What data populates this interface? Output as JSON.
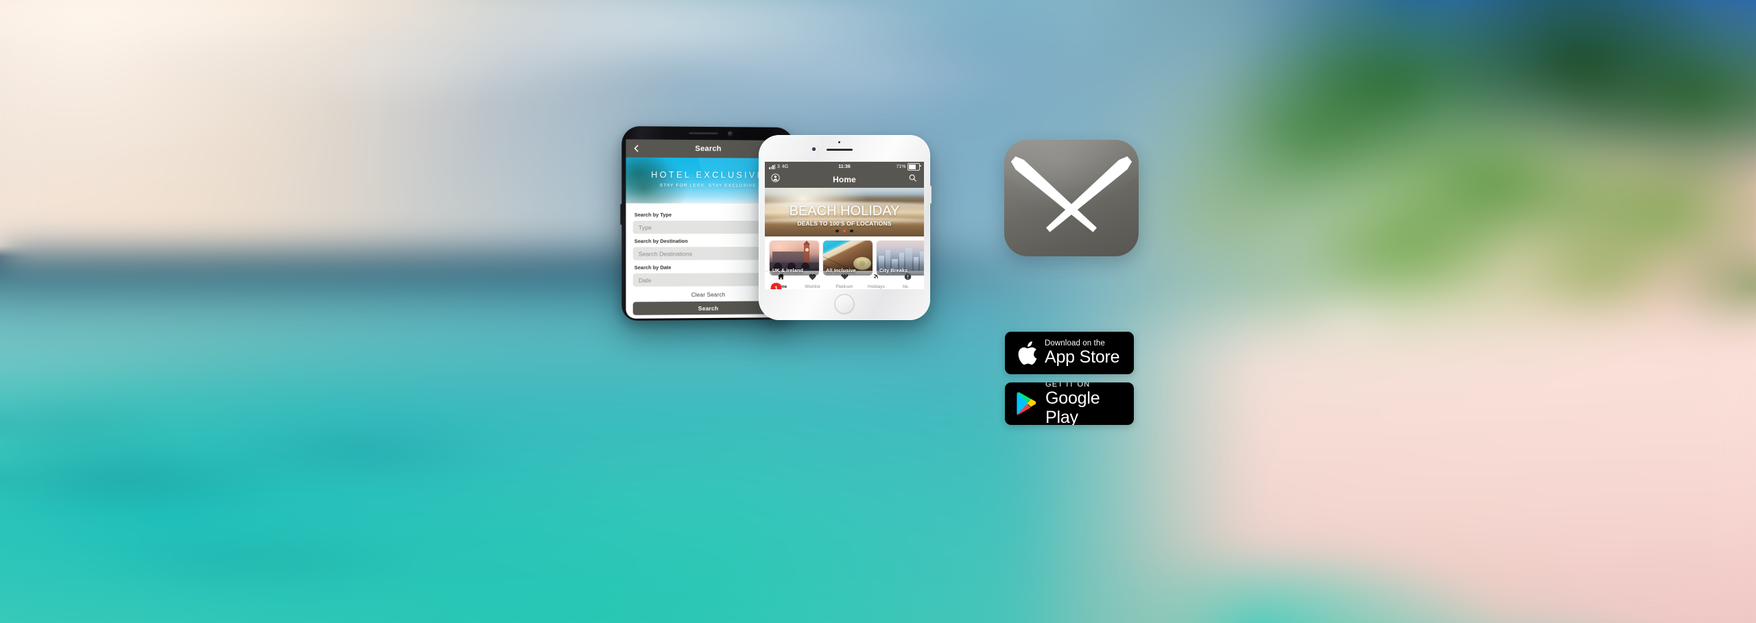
{
  "background": {
    "scene": "blurred tropical beach with turquoise sea, pink sand and palm foliage",
    "colors": {
      "sea_turquoise": "#2ec4ba",
      "sand_pink": "#f6dcd6",
      "foliage_green": "#4a8c2e",
      "sky_blue": "#2a74b8",
      "sunrise_cream": "#f2e3dc"
    }
  },
  "android_phone": {
    "device": "android-handset",
    "appbar": {
      "back_icon": "chevron-left-icon",
      "title": "Search"
    },
    "hero": {
      "brand": "HOTEL  EXCLUSIVE",
      "tagline": "STAY FOR LESS. STAY EXCLUSIVE"
    },
    "form": {
      "fields": [
        {
          "label": "Search by Type",
          "placeholder": "Type",
          "value": ""
        },
        {
          "label": "Search by Destination",
          "placeholder": "Search Destinations",
          "value": ""
        },
        {
          "label": "Search by Date",
          "placeholder": "Date",
          "value": ""
        }
      ],
      "clear_label": "Clear Search",
      "submit_label": "Search"
    },
    "colors": {
      "appbar": "#585651",
      "hero_blue": "#23bdeb",
      "button": "#585651",
      "input": "#e3e3e1"
    }
  },
  "iphone": {
    "device": "iphone-handset",
    "status_bar": {
      "signal_icon": "signal-bars-icon",
      "signal_strength": "3",
      "network": "4G",
      "time": "11:36",
      "battery_percent": "71%",
      "battery_icon": "battery-icon",
      "battery_level": 71
    },
    "nav": {
      "profile_icon": "profile-icon",
      "title": "Home",
      "search_icon": "search-icon"
    },
    "hero": {
      "title": "BEACH HOLIDAY",
      "subtitle": "DEALS TO 100'S OF LOCATIONS",
      "dots_total": 3,
      "dots_active_index": 1,
      "active_dot_color": "#f4544c",
      "dot_color": "#1c1c1c"
    },
    "tiles": [
      {
        "label": "UK & Ireland",
        "image": "westminster-big-ben-at-dusk"
      },
      {
        "label": "All Inclusive",
        "image": "poolside-deck-with-straw-hat"
      },
      {
        "label": "City Breaks",
        "image": "city-skyline"
      }
    ],
    "promo": {
      "badge_count": "1",
      "badge_color": "#e8231e",
      "wishlist_icon": "heart-icon",
      "image": "blue-sky-with-palm-trees"
    },
    "tabs": [
      {
        "label": "Home",
        "icon": "home-icon",
        "active": true
      },
      {
        "label": "Wishlist",
        "icon": "heart-icon",
        "active": false
      },
      {
        "label": "Platinum",
        "icon": "diamond-icon",
        "active": false
      },
      {
        "label": "Holidays",
        "icon": "airplane-icon",
        "active": false
      },
      {
        "label": "Alerts",
        "icon": "alert-icon",
        "active": false
      }
    ],
    "colors": {
      "navbar": "#585651",
      "tab_active": "#1b1b1b",
      "tab_inactive": "#8b8b8b"
    }
  },
  "app_icon": {
    "name": "app-icon-x",
    "glyph": "X",
    "background_color": "#6a6964",
    "glyph_color": "#ffffff"
  },
  "store_badges": [
    {
      "name": "app-store-badge",
      "icon": "apple-logo-icon",
      "small_text": "Download on the",
      "big_text": "App Store"
    },
    {
      "name": "google-play-badge",
      "icon": "google-play-triangle-icon",
      "small_text": "GET IT ON",
      "big_text": "Google Play"
    }
  ]
}
